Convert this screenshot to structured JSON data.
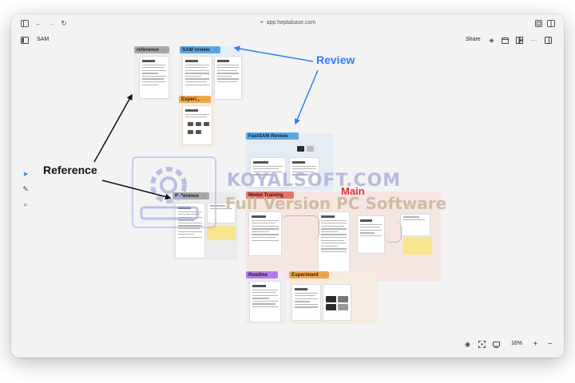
{
  "browser": {
    "url": "app.heptabase.com",
    "icons": [
      "sidebar-icon",
      "back-icon",
      "forward-icon",
      "reload-icon",
      "extension-icon",
      "split-view-icon"
    ]
  },
  "app": {
    "title": "SAM",
    "share_label": "Share"
  },
  "canvas": {
    "groups": [
      {
        "label": "reference",
        "color": "#9e9e9e"
      },
      {
        "label": "SAM review",
        "color": "#5aa9e6"
      },
      {
        "label": "Experi...",
        "color": "#f0a64a"
      },
      {
        "label": "FastSAM Review",
        "color": "#5aa9e6"
      },
      {
        "label": "Reference",
        "color": "#9e9e9e"
      },
      {
        "label": "Model Training",
        "color": "#e9746a"
      },
      {
        "label": "Readme",
        "color": "#b57be6"
      },
      {
        "label": "Experiment",
        "color": "#f0a64a"
      }
    ],
    "group_menu": "···"
  },
  "annotations": {
    "review": "Review",
    "reference": "Reference",
    "main": "Main",
    "review_color": "#2f7df6",
    "main_color": "#e0323c"
  },
  "watermark": {
    "title": "KOYALSOFT.COM",
    "subtitle": "Full Version PC Software"
  },
  "footer": {
    "zoom": "16%",
    "zoom_in": "+",
    "zoom_out": "−"
  }
}
